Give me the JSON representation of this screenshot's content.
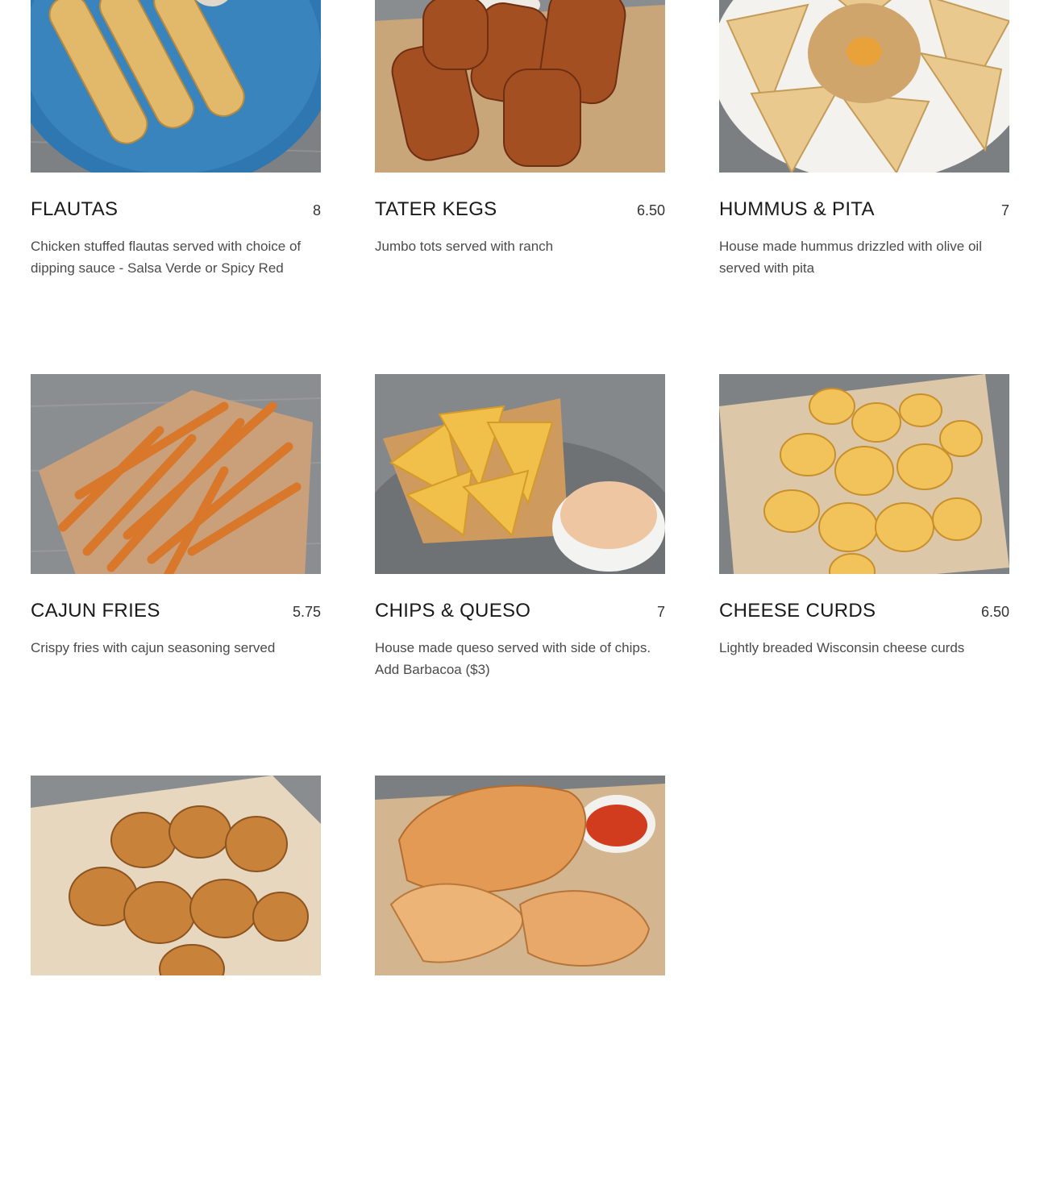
{
  "menu": {
    "items": [
      {
        "name": "Flautas",
        "price": "8",
        "description": "Chicken stuffed flautas served with choice of dipping sauce - Salsa Verde or Spicy Red",
        "photo_icon": "flautas-photo"
      },
      {
        "name": "Tater Kegs",
        "price": "6.50",
        "description": "Jumbo tots served with ranch",
        "photo_icon": "tater-kegs-photo"
      },
      {
        "name": "Hummus & Pita",
        "price": "7",
        "description": "House made hummus drizzled with olive oil served with pita",
        "photo_icon": "hummus-pita-photo"
      },
      {
        "name": "Cajun Fries",
        "price": "5.75",
        "description": "Crispy fries with cajun seasoning served",
        "photo_icon": "cajun-fries-photo"
      },
      {
        "name": "Chips & Queso",
        "price": "7",
        "description": "House made queso served with side of chips. Add Barbacoa ($3)",
        "photo_icon": "chips-queso-photo"
      },
      {
        "name": "Cheese Curds",
        "price": "6.50",
        "description": "Lightly breaded Wisconsin cheese curds",
        "photo_icon": "cheese-curds-photo"
      },
      {
        "name": "",
        "price": "",
        "description": "",
        "photo_icon": "corn-dogs-photo"
      },
      {
        "name": "",
        "price": "",
        "description": "",
        "photo_icon": "chicharrones-photo"
      }
    ]
  },
  "colors": {
    "text": "#1a1a1a",
    "description": "#4b4b4b",
    "wood": "#8a8d90",
    "plate_blue": "#2f77b0",
    "paper": "#c9a57a"
  }
}
